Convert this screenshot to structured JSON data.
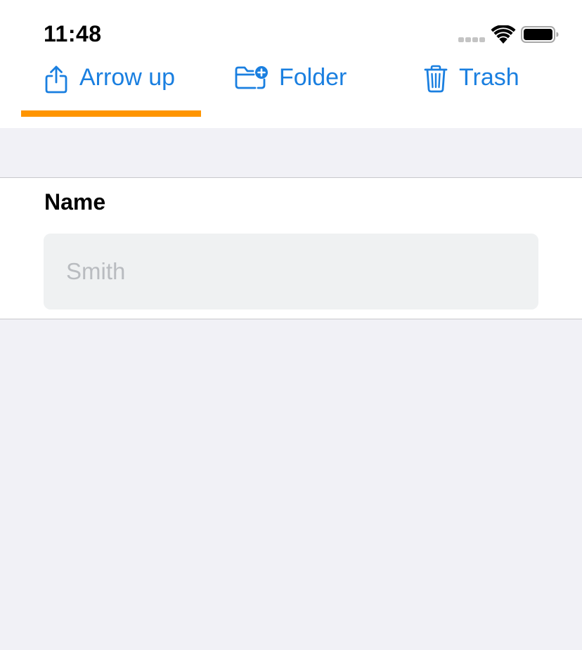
{
  "status_bar": {
    "time": "11:48"
  },
  "tabs": [
    {
      "label": "Arrow up",
      "icon": "share-arrow-up-icon",
      "selected": true
    },
    {
      "label": "Folder",
      "icon": "folder-add-icon",
      "selected": false
    },
    {
      "label": "Trash",
      "icon": "trash-icon",
      "selected": false
    }
  ],
  "form": {
    "name_label": "Name",
    "name_value": "",
    "name_placeholder": "Smith"
  },
  "colors": {
    "accent_blue": "#1a7fe0",
    "tab_indicator": "#ff9500",
    "background": "#f1f1f6",
    "input_background": "#eff1f2",
    "placeholder": "#b9bcc0"
  }
}
